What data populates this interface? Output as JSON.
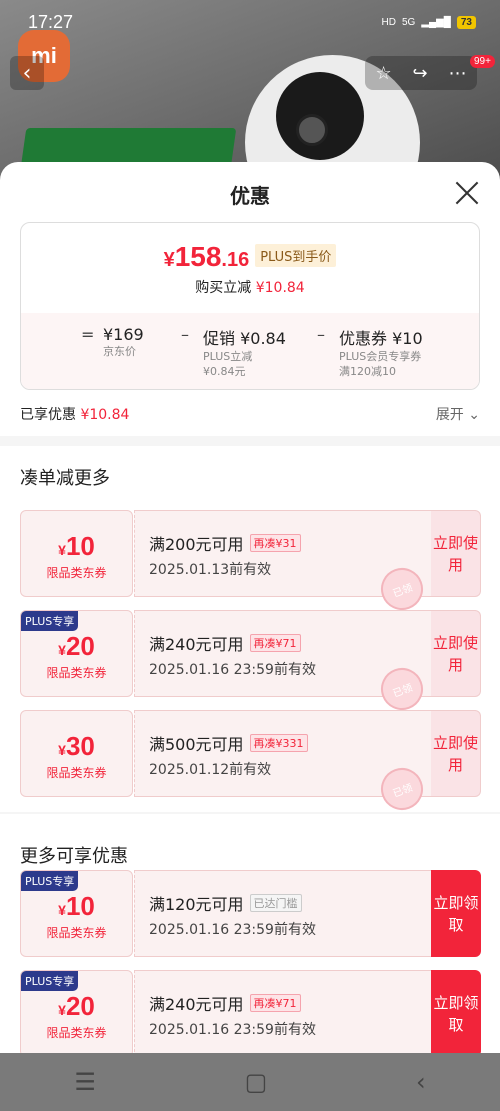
{
  "status_bar": {
    "time": "17:27",
    "hd": "HD",
    "network": "5G",
    "battery": "73"
  },
  "background": {
    "logo_text": "mi",
    "cart_badge": "99+"
  },
  "sheet": {
    "title": "优惠",
    "price": {
      "currency": "¥",
      "integer": "158",
      "decimal": ".16",
      "plus_label": "PLUS到手价",
      "reduce_label": "购买立减",
      "reduce_amount": "¥10.84"
    },
    "breakdown": [
      {
        "symbol": "=",
        "main": "¥169",
        "sub1": "京东价",
        "sub2": ""
      },
      {
        "symbol": "–",
        "main": "促销 ¥0.84",
        "sub1": "PLUS立减",
        "sub2": "¥0.84元"
      },
      {
        "symbol": "–",
        "main": "优惠券 ¥10",
        "sub1": "PLUS会员专享券",
        "sub2": "满120减10"
      }
    ],
    "enjoyed_label": "已享优惠",
    "enjoyed_amount": "¥10.84",
    "expand_label": "展开 ⌄",
    "section1_title": "凑单减更多",
    "section2_title": "更多可享优惠",
    "coupons": [
      {
        "plus": "",
        "currency": "¥",
        "amount": "10",
        "category": "限品类东券",
        "condition": "满200元可用",
        "tag": "再凑¥31",
        "expiry": "2025.01.13前有效",
        "action": "立即使用",
        "stamp": "已领"
      },
      {
        "plus": "PLUS专享",
        "currency": "¥",
        "amount": "20",
        "category": "限品类东券",
        "condition": "满240元可用",
        "tag": "再凑¥71",
        "expiry": "2025.01.16 23:59前有效",
        "action": "立即使用",
        "stamp": "已领"
      },
      {
        "plus": "",
        "currency": "¥",
        "amount": "30",
        "category": "限品类东券",
        "condition": "满500元可用",
        "tag": "再凑¥331",
        "expiry": "2025.01.12前有效",
        "action": "立即使用",
        "stamp": "已领"
      },
      {
        "plus": "PLUS专享",
        "currency": "¥",
        "amount": "10",
        "category": "限品类东券",
        "condition": "满120元可用",
        "tag": "已达门槛",
        "expiry": "2025.01.16 23:59前有效",
        "action": "立即领取",
        "stamp": ""
      },
      {
        "plus": "PLUS专享",
        "currency": "¥",
        "amount": "20",
        "category": "限品类东券",
        "condition": "满240元可用",
        "tag": "再凑¥71",
        "expiry": "2025.01.16 23:59前有效",
        "action": "立即领取",
        "stamp": ""
      }
    ]
  },
  "nav_icons": [
    "menu-icon",
    "home-icon",
    "back-icon"
  ]
}
